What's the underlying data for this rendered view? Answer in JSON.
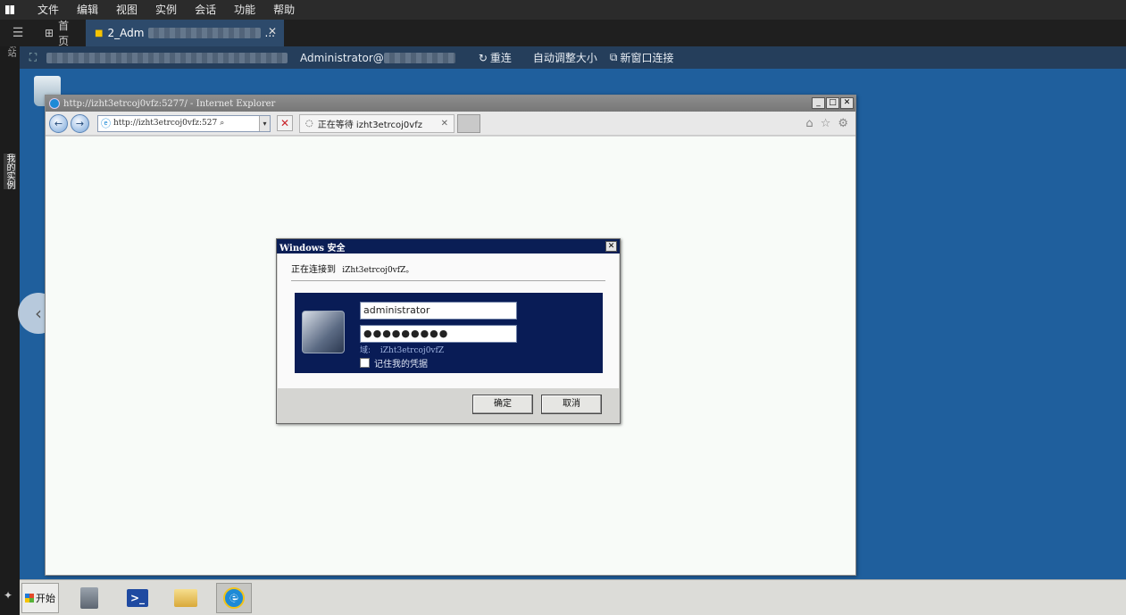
{
  "menubar": {
    "items": [
      "文件",
      "编辑",
      "视图",
      "实例",
      "会话",
      "功能",
      "帮助"
    ]
  },
  "tabs": {
    "home_label": "首页",
    "session_label": "2_Adm",
    "session_suffix": "..."
  },
  "connection": {
    "user_label": "Administrator@",
    "reconnect_label": "重连",
    "autoresize_label": "自动调整大小",
    "new_window_label": "新窗口连接"
  },
  "left_rail": {
    "items": [
      "回收站",
      "我的实例"
    ]
  },
  "ie": {
    "title": "http://izht3etrcoj0vfz:5277/ - Internet Explorer",
    "address": "http://izht3etrcoj0vfz:527",
    "tab_label": "正在等待 izht3etrcoj0vfz"
  },
  "dialog": {
    "title": "Windows 安全",
    "message": "正在连接到",
    "host": "iZht3etrcoj0vfZ。",
    "username": "administrator",
    "password_mask": "●●●●●●●●●",
    "domain_label": "域:",
    "domain_value": "iZht3etrcoj0vfZ",
    "remember_label": "记住我的凭据",
    "ok_label": "确定",
    "cancel_label": "取消"
  },
  "taskbar": {
    "start_label": "开始"
  }
}
